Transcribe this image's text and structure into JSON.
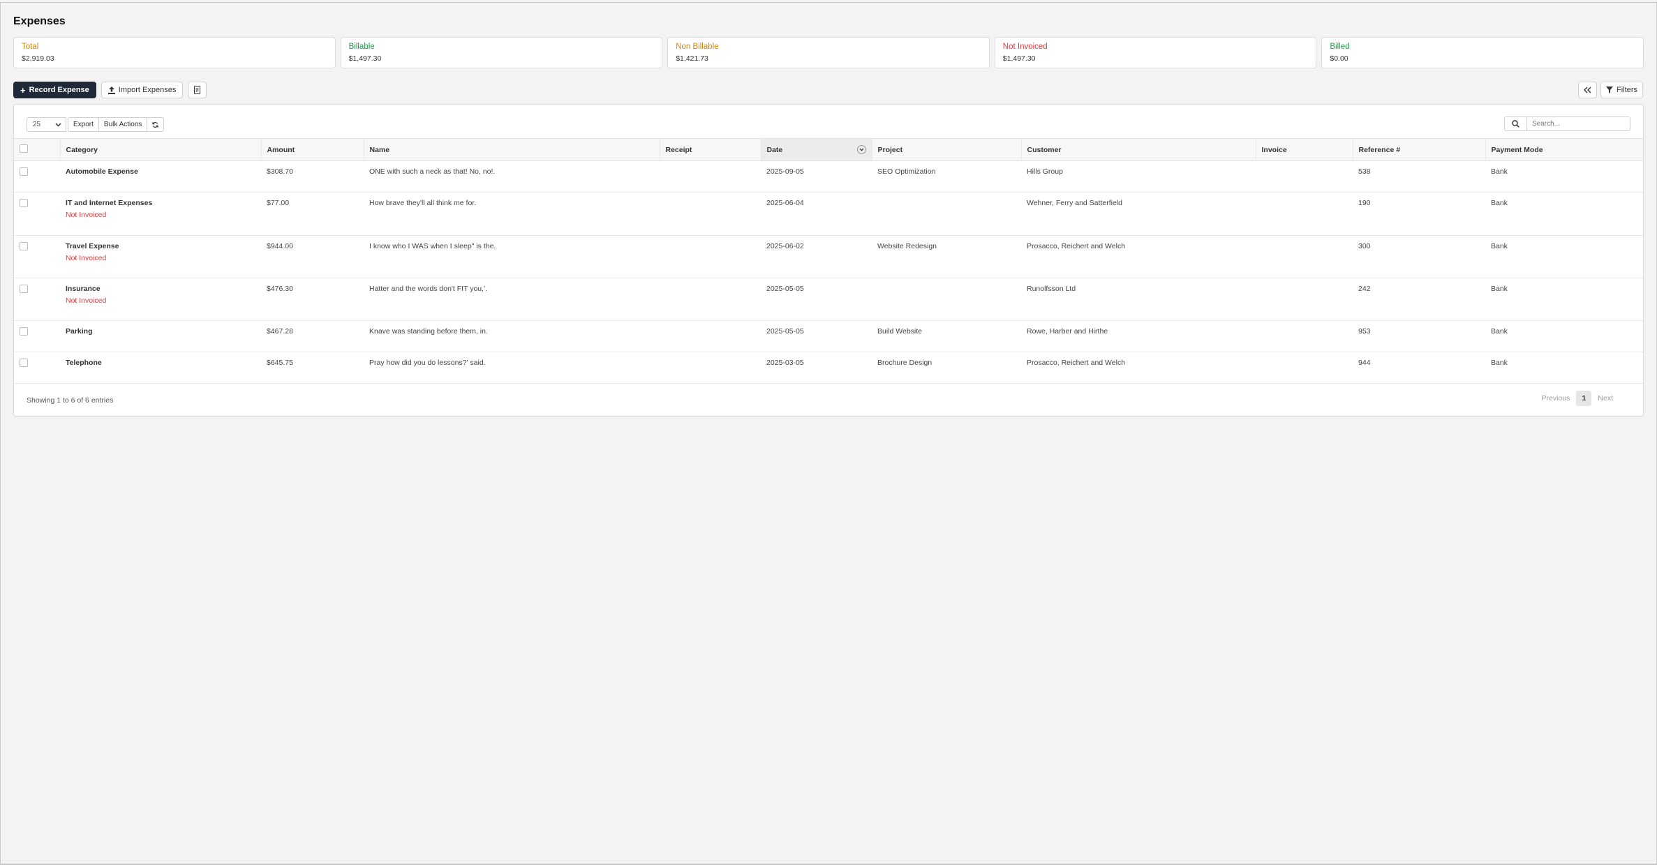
{
  "page": {
    "title": "Expenses"
  },
  "stats": [
    {
      "label": "Total",
      "value": "$2,919.03",
      "color": "#d4860b"
    },
    {
      "label": "Billable",
      "value": "$1,497.30",
      "color": "#1e9a45"
    },
    {
      "label": "Non Billable",
      "value": "$1,421.73",
      "color": "#d4860b"
    },
    {
      "label": "Not Invoiced",
      "value": "$1,497.30",
      "color": "#e23b3b"
    },
    {
      "label": "Billed",
      "value": "$0.00",
      "color": "#1e9a45"
    }
  ],
  "toolbar": {
    "record_label": "Record Expense",
    "import_label": "Import Expenses",
    "filters_label": "Filters"
  },
  "table_controls": {
    "page_length": "25",
    "export_label": "Export",
    "bulk_label": "Bulk Actions",
    "search_placeholder": "Search..."
  },
  "columns": [
    "Category",
    "Amount",
    "Name",
    "Receipt",
    "Date",
    "Project",
    "Customer",
    "Invoice",
    "Reference #",
    "Payment Mode"
  ],
  "rows": [
    {
      "category": "Automobile Expense",
      "status": "",
      "amount": "$308.70",
      "name": "ONE with such a neck as that! No, no!.",
      "receipt": "",
      "date": "2025-09-05",
      "project": "SEO Optimization",
      "customer": "Hills Group",
      "invoice": "",
      "reference": "538",
      "payment_mode": "Bank"
    },
    {
      "category": "IT and Internet Expenses",
      "status": "Not Invoiced",
      "amount": "$77.00",
      "name": "How brave they'll all think me for.",
      "receipt": "",
      "date": "2025-06-04",
      "project": "",
      "customer": "Wehner, Ferry and Satterfield",
      "invoice": "",
      "reference": "190",
      "payment_mode": "Bank"
    },
    {
      "category": "Travel Expense",
      "status": "Not Invoiced",
      "amount": "$944.00",
      "name": "I know who I WAS when I sleep\" is the.",
      "receipt": "",
      "date": "2025-06-02",
      "project": "Website Redesign",
      "customer": "Prosacco, Reichert and Welch",
      "invoice": "",
      "reference": "300",
      "payment_mode": "Bank"
    },
    {
      "category": "Insurance",
      "status": "Not Invoiced",
      "amount": "$476.30",
      "name": "Hatter and the words don't FIT you,'.",
      "receipt": "",
      "date": "2025-05-05",
      "project": "",
      "customer": "Runolfsson Ltd",
      "invoice": "",
      "reference": "242",
      "payment_mode": "Bank"
    },
    {
      "category": "Parking",
      "status": "",
      "amount": "$467.28",
      "name": "Knave was standing before them, in.",
      "receipt": "",
      "date": "2025-05-05",
      "project": "Build Website",
      "customer": "Rowe, Harber and Hirthe",
      "invoice": "",
      "reference": "953",
      "payment_mode": "Bank"
    },
    {
      "category": "Telephone",
      "status": "",
      "amount": "$645.75",
      "name": "Pray how did you do lessons?' said.",
      "receipt": "",
      "date": "2025-03-05",
      "project": "Brochure Design",
      "customer": "Prosacco, Reichert and Welch",
      "invoice": "",
      "reference": "944",
      "payment_mode": "Bank"
    }
  ],
  "footer": {
    "info": "Showing 1 to 6 of 6 entries",
    "previous": "Previous",
    "current_page": "1",
    "next": "Next"
  }
}
